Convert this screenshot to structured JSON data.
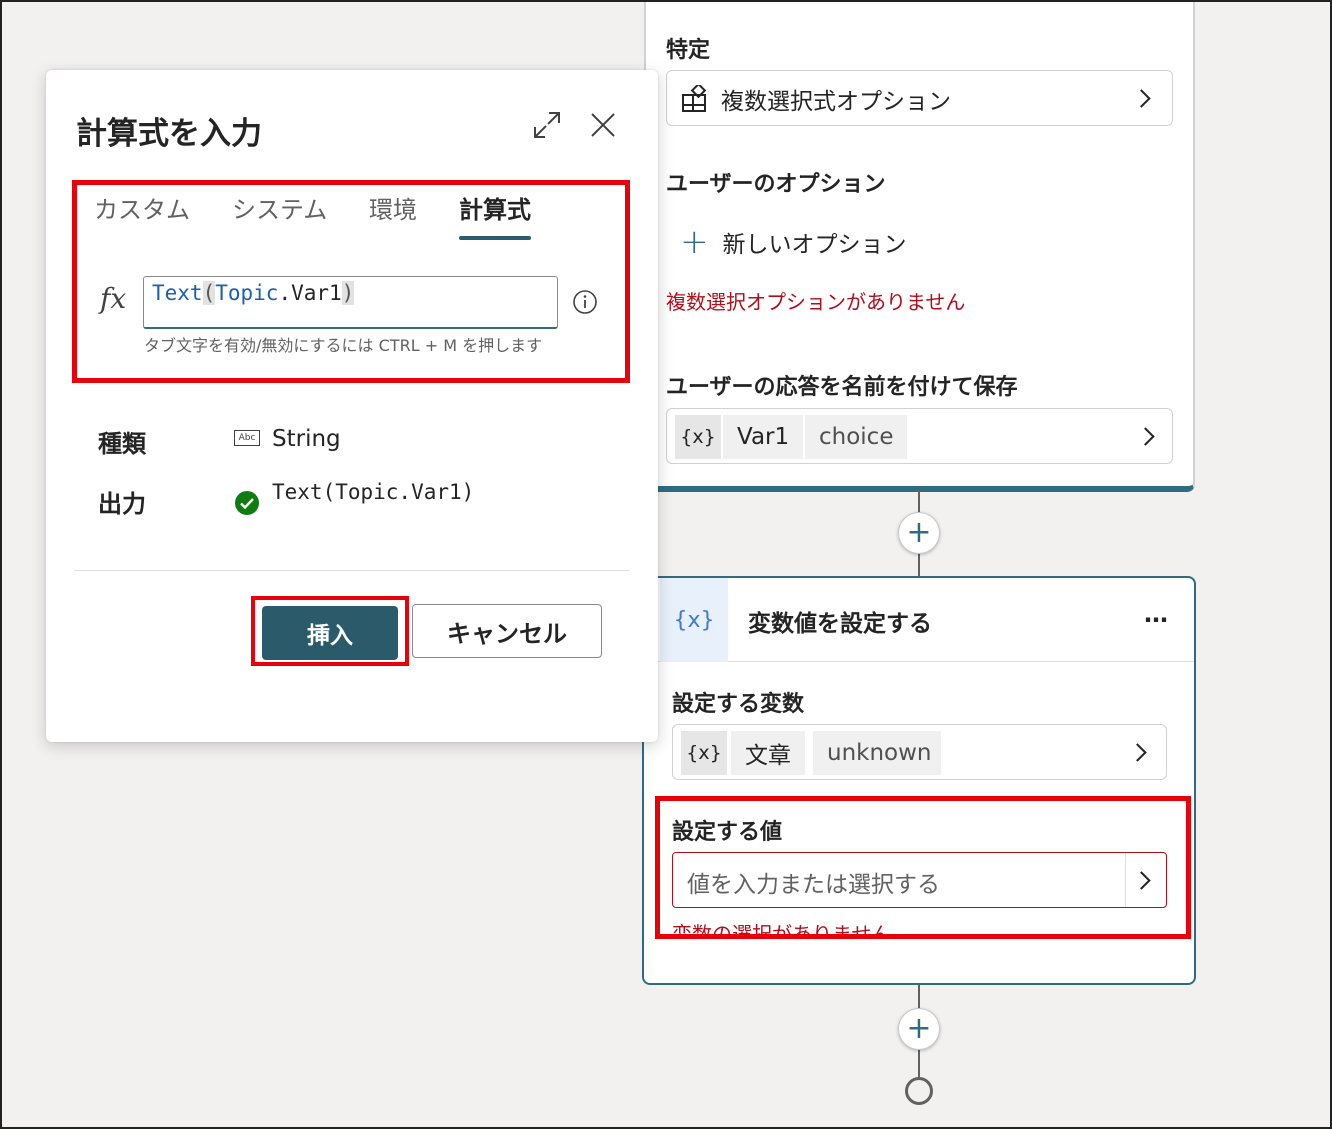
{
  "dialog": {
    "title": "計算式を入力",
    "tabs": [
      "カスタム",
      "システム",
      "環境",
      "計算式"
    ],
    "active_tab": "計算式",
    "fx_symbol": "fx",
    "formula": {
      "func": "Text",
      "open_paren": "(",
      "arg_obj": "Topic",
      "arg_rest": ".Var1",
      "close_paren": ")"
    },
    "hint": "タブ文字を有効/無効にするには CTRL + M を押します",
    "type_label": "種類",
    "type_icon_text": "Abc",
    "type_value": "String",
    "output_label": "出力",
    "output_value": "Text(Topic.Var1)",
    "insert_label": "挿入",
    "cancel_label": "キャンセル",
    "icons": [
      "expand-icon",
      "close-icon",
      "info-icon",
      "check-circle-icon",
      "abc-type-icon"
    ]
  },
  "question_card": {
    "identify_label": "特定",
    "identify_value": "複数選択式オプション",
    "user_options_label": "ユーザーのオプション",
    "new_option_label": "新しいオプション",
    "no_options_error": "複数選択オプションがありません",
    "save_response_label": "ユーザーの応答を名前を付けて保存",
    "var_icon": "{x}",
    "var_name": "Var1",
    "var_type": "choice"
  },
  "set_variable_card": {
    "icon": "{x}",
    "title": "変数値を設定する",
    "more_label": "…",
    "variable_label": "設定する変数",
    "var_icon": "{x}",
    "var_name": "文章",
    "var_type": "unknown",
    "value_label": "設定する値",
    "value_placeholder": "値を入力または選択する",
    "value_error": "変数の選択がありません"
  },
  "canvas": {
    "plus_label": "+",
    "accent_color": "#2f6c80",
    "error_color": "#b10e1c",
    "highlight_color": "#e8000b"
  }
}
